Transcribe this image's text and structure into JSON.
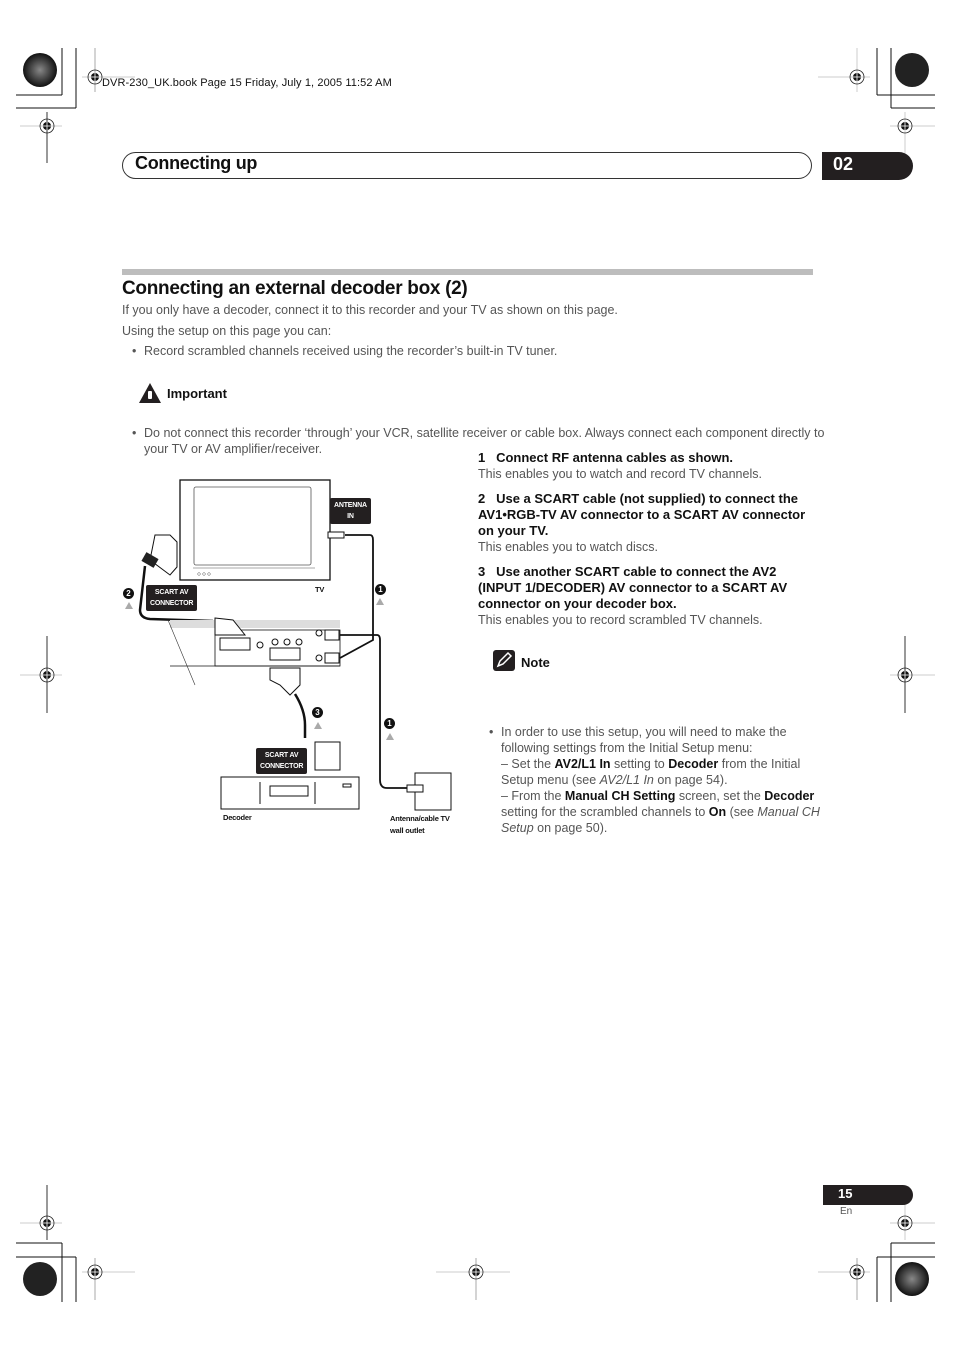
{
  "print_header": "DVR-230_UK.book  Page 15  Friday, July 1, 2005  11:52 AM",
  "chapter": {
    "title": "Connecting up",
    "number": "02"
  },
  "section": {
    "title": "Connecting an external decoder box (2)",
    "intro": "If you only have a decoder, connect it to this recorder and your TV as shown on this page.",
    "lead": "Using the setup on this page you can:",
    "bullets": [
      "Record scrambled channels received using the recorder’s built-in TV tuner."
    ]
  },
  "important": {
    "label": "Important",
    "icon": "warning-hand-icon",
    "text": "Do not connect this recorder ‘through’ your VCR, satellite receiver or cable box. Always connect each component directly to your TV or AV amplifier/receiver."
  },
  "steps": [
    {
      "num": "1",
      "heading": "Connect RF antenna cables as shown.",
      "desc": "This enables you to watch and record TV channels."
    },
    {
      "num": "2",
      "heading": "Use a SCART cable (not supplied) to connect the AV1•RGB-TV AV connector to a SCART AV connector on your TV.",
      "desc": "This enables you to watch discs."
    },
    {
      "num": "3",
      "heading": "Use another SCART cable to connect the AV2 (INPUT 1/DECODER) AV connector to a SCART AV connector on your decoder box.",
      "desc": "This enables you to record scrambled TV channels."
    }
  ],
  "note": {
    "label": "Note",
    "icon": "pencil-note-icon",
    "intro": "In order to use this setup, you will need to make the following settings from the Initial Setup menu:",
    "line1": {
      "a": "– Set the ",
      "b1": "AV2/L1 In",
      "c": " setting to ",
      "b2": "Decoder",
      "d": " from the Initial Setup menu (see ",
      "i": "AV2/L1 In",
      "e": " on page 54)."
    },
    "line2": {
      "a": "– From the ",
      "b1": "Manual CH Setting",
      "c": " screen, set the ",
      "b2": "Decoder",
      "d": " setting for the scrambled channels to ",
      "b3": "On",
      "e": " (see ",
      "i": "Manual CH Setup",
      "f": " on page 50)."
    }
  },
  "diagram": {
    "tv_label": "TV",
    "antenna_in_line1": "ANTENNA",
    "antenna_in_line2": "IN",
    "scart_tag_line1": "SCART AV",
    "scart_tag_line2": "CONNECTOR",
    "decoder_label": "Decoder",
    "wall_outlet_line1": "Antenna/cable TV",
    "wall_outlet_line2": "wall outlet",
    "badges": [
      "1",
      "2",
      "3",
      "1"
    ]
  },
  "footer": {
    "page": "15",
    "lang": "En"
  }
}
